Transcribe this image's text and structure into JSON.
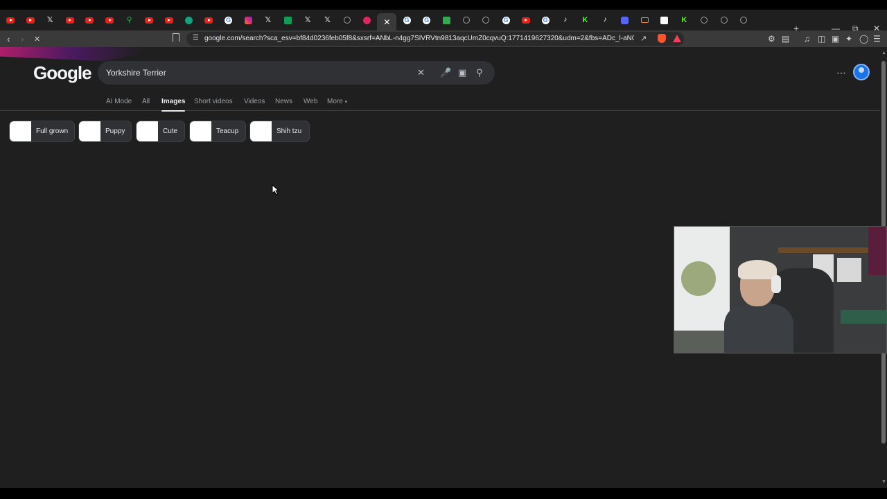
{
  "browser": {
    "tabs": [
      {
        "icon": "youtube-icon",
        "kind": "yt"
      },
      {
        "icon": "youtube-icon",
        "kind": "yt"
      },
      {
        "icon": "x-icon",
        "kind": "x"
      },
      {
        "icon": "youtube-icon",
        "kind": "yt"
      },
      {
        "icon": "youtube-icon",
        "kind": "yt"
      },
      {
        "icon": "youtube-icon",
        "kind": "yt"
      },
      {
        "icon": "maps-icon",
        "kind": "maps"
      },
      {
        "icon": "youtube-icon",
        "kind": "yt"
      },
      {
        "icon": "youtube-icon",
        "kind": "yt"
      },
      {
        "icon": "chatgpt-icon",
        "kind": "chatgpt"
      },
      {
        "icon": "youtube-icon",
        "kind": "yt"
      },
      {
        "icon": "google-icon",
        "kind": "google"
      },
      {
        "icon": "instagram-icon",
        "kind": "insta"
      },
      {
        "icon": "x-icon",
        "kind": "x"
      },
      {
        "icon": "sheets-icon",
        "kind": "sheets"
      },
      {
        "icon": "x-icon",
        "kind": "x"
      },
      {
        "icon": "x-icon",
        "kind": "x"
      },
      {
        "icon": "globe-icon",
        "kind": "globe"
      },
      {
        "icon": "pink-app-icon",
        "kind": "pink"
      },
      {
        "icon": "close-icon",
        "kind": "active"
      },
      {
        "icon": "google-icon",
        "kind": "google"
      },
      {
        "icon": "google-icon",
        "kind": "google"
      },
      {
        "icon": "green-app-icon",
        "kind": "green"
      },
      {
        "icon": "globe-icon",
        "kind": "globe"
      },
      {
        "icon": "globe-icon",
        "kind": "globe"
      },
      {
        "icon": "google-icon",
        "kind": "google"
      },
      {
        "icon": "youtube-icon",
        "kind": "yt"
      },
      {
        "icon": "google-icon",
        "kind": "google"
      },
      {
        "icon": "tiktok-icon",
        "kind": "tiktok"
      },
      {
        "icon": "kick-icon",
        "kind": "kick"
      },
      {
        "icon": "tiktok-icon",
        "kind": "tiktok"
      },
      {
        "icon": "discord-icon",
        "kind": "discord"
      },
      {
        "icon": "monitor-icon",
        "kind": "orange"
      },
      {
        "icon": "doc-icon",
        "kind": "doc"
      },
      {
        "icon": "kick-icon",
        "kind": "kick"
      },
      {
        "icon": "globe-icon",
        "kind": "globe"
      },
      {
        "icon": "globe-icon",
        "kind": "globe"
      },
      {
        "icon": "globe-icon",
        "kind": "globe"
      }
    ],
    "url": "google.com/search?sca_esv=bf84d0236feb05f8&sxsrf=ANbL-n4gg7SIVRVtn9813aqcUmZ0cqvuQ:1771419627320&udm=2&fbs=ADc_l-aN0CWEZBO..."
  },
  "google": {
    "logo": "Google",
    "query": "Yorkshire Terrier",
    "tabs": [
      "AI Mode",
      "All",
      "Images",
      "Short videos",
      "Videos",
      "News",
      "Web",
      "More"
    ],
    "active_tab": "Images",
    "chips": [
      "Full grown",
      "Puppy",
      "Cute",
      "Teacup",
      "Shih tzu"
    ]
  }
}
